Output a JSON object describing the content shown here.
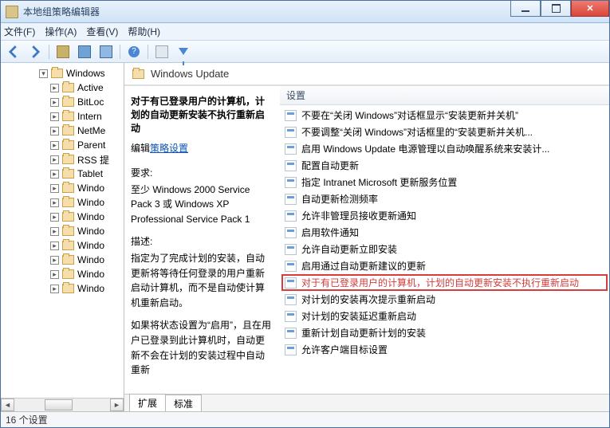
{
  "window": {
    "title": "本地组策略编辑器"
  },
  "menu": {
    "file": "文件(F)",
    "action": "操作(A)",
    "view": "查看(V)",
    "help": "帮助(H)"
  },
  "tree": {
    "root": "Windows",
    "items": [
      "Active",
      "BitLoc",
      "Intern",
      "NetMe",
      "Parent",
      "RSS 提",
      "Tablet",
      "Windo",
      "Windo",
      "Windo",
      "Windo",
      "Windo",
      "Windo",
      "Windo",
      "Windo"
    ]
  },
  "header": {
    "title": "Windows Update"
  },
  "description": {
    "title": "对于有已登录用户的计算机，计划的自动更新安装不执行重新启动",
    "edit_prefix": "编辑",
    "edit_link": "策略设置",
    "req_label": "要求:",
    "req_text": "至少 Windows 2000 Service Pack 3 或 Windows XP Professional Service Pack 1",
    "desc_label": "描述:",
    "desc_p1": "指定为了完成计划的安装，自动更新将等待任何登录的用户重新启动计算机，而不是自动使计算机重新启动。",
    "desc_p2": "如果将状态设置为“启用”，且在用户已登录到此计算机时，自动更新不会在计划的安装过程中自动重新"
  },
  "list": {
    "column": "设置",
    "items": [
      "不要在“关闭 Windows”对话框显示“安装更新并关机”",
      "不要调整“关闭 Windows”对话框里的“安装更新并关机...",
      "启用 Windows Update 电源管理以自动唤醒系统来安装计...",
      "配置自动更新",
      "指定 Intranet Microsoft 更新服务位置",
      "自动更新检测频率",
      "允许非管理员接收更新通知",
      "启用软件通知",
      "允许自动更新立即安装",
      "启用通过自动更新建议的更新",
      "对于有已登录用户的计算机，计划的自动更新安装不执行重新启动",
      "对计划的安装再次提示重新启动",
      "对计划的安装延迟重新启动",
      "重新计划自动更新计划的安装",
      "允许客户端目标设置"
    ],
    "highlight_index": 10
  },
  "tabs": {
    "extended": "扩展",
    "standard": "标准"
  },
  "status": {
    "text": "16 个设置"
  }
}
